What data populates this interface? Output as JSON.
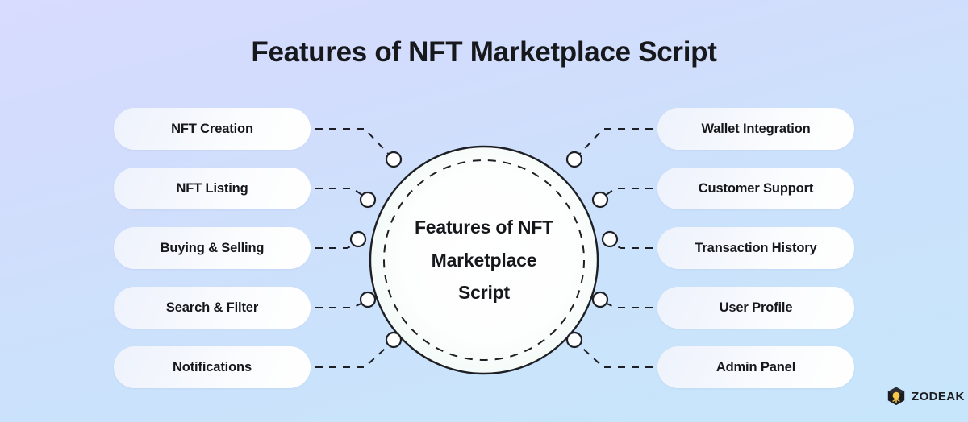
{
  "title": "Features of NFT Marketplace Script",
  "hub": {
    "lines": [
      "Features of NFT",
      "Marketplace",
      "Script"
    ]
  },
  "features": {
    "left": [
      {
        "label": "NFT Creation"
      },
      {
        "label": "NFT Listing"
      },
      {
        "label": "Buying & Selling"
      },
      {
        "label": "Search & Filter"
      },
      {
        "label": "Notifications"
      }
    ],
    "right": [
      {
        "label": "Wallet Integration"
      },
      {
        "label": "Customer Support"
      },
      {
        "label": "Transaction History"
      },
      {
        "label": "User Profile"
      },
      {
        "label": "Admin Panel"
      }
    ]
  },
  "brand": {
    "name": "ZODEAK",
    "icon": "cube-logo-icon"
  },
  "colors": {
    "background_top": "#d8dcff",
    "background_bottom": "#c7e6fb",
    "text": "#16171b",
    "pill_fill": "#ffffff",
    "hub_fill": "#f4fbf8",
    "stroke": "#1d1f24",
    "brand_accent": "#f7c948"
  }
}
